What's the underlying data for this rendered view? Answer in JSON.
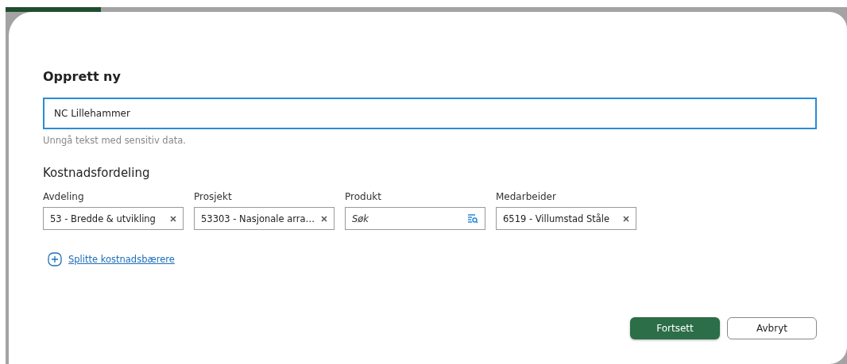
{
  "dialog": {
    "title": "Opprett ny",
    "name_field": {
      "value": "NC Lillehammer",
      "focused": true
    },
    "hint": "Unngå tekst med sensitiv data.",
    "section_title": "Kostnadsfordeling",
    "fields": [
      {
        "label": "Avdeling",
        "kind": "select",
        "value": "53 - Bredde & utvikling"
      },
      {
        "label": "Prosjekt",
        "kind": "select",
        "value": "53303 - Nasjonale arra…"
      },
      {
        "label": "Produkt",
        "kind": "search",
        "placeholder": "Søk"
      },
      {
        "label": "Medarbeider",
        "kind": "select",
        "value": "6519 - Villumstad Ståle"
      }
    ],
    "split_link": "Splitte kostnadsbærere",
    "buttons": [
      {
        "label": "Fortsett",
        "kind": "primary"
      },
      {
        "label": "Avbryt",
        "kind": "secondary"
      }
    ]
  }
}
